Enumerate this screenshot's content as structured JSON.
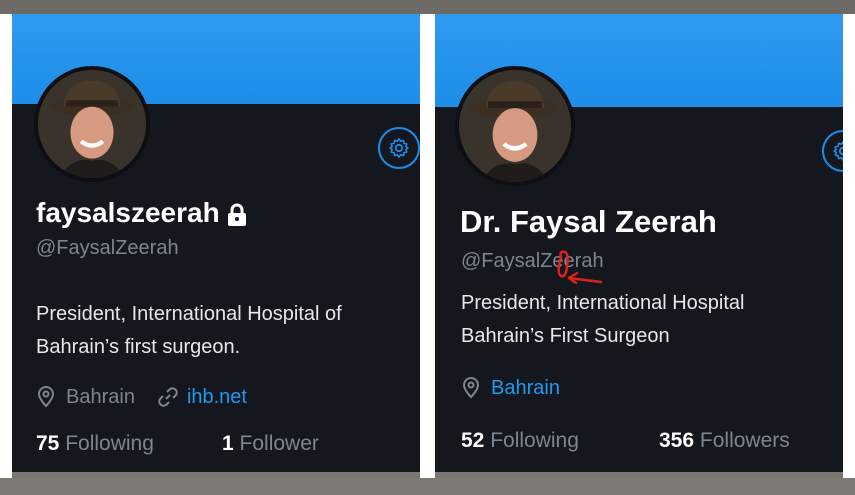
{
  "left_profile": {
    "display_name": "faysalszeerah",
    "handle": "@FaysalZeerah",
    "bio_line1": "President, International Hospital of",
    "bio_line2": "Bahrain’s first surgeon.",
    "location": "Bahrain",
    "website": "ihb.net",
    "following_count": "75",
    "following_label": "Following",
    "followers_count": "1",
    "followers_label": "Follower",
    "icons": [
      "settings-gear-icon",
      "lock-icon",
      "location-pin-icon",
      "link-icon"
    ]
  },
  "right_profile": {
    "display_name": "Dr. Faysal Zeerah",
    "handle": "@FaysalZeerah",
    "bio_line1": "President, International Hospital",
    "bio_line2": "Bahrain’s First Surgeon",
    "location": "Bahrain",
    "following_count": "52",
    "following_label": "Following",
    "followers_count": "356",
    "followers_label": "Followers",
    "icons": [
      "settings-gear-icon",
      "location-pin-icon"
    ]
  },
  "colors": {
    "banner": "#1d8de8",
    "background": "#15171e",
    "accent": "#1d9bf0",
    "annotation": "#e0201b"
  }
}
